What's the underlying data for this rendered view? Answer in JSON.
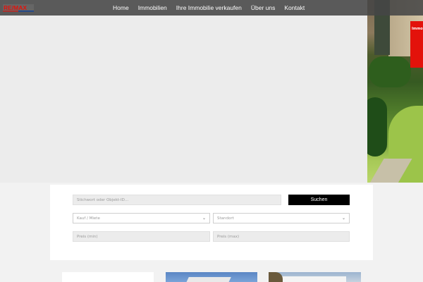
{
  "header": {
    "logo_icon": "remax-logo",
    "nav": [
      {
        "label": "Home"
      },
      {
        "label": "Immobilien"
      },
      {
        "label": "Ihre Immobilie verkaufen"
      },
      {
        "label": "Über uns"
      },
      {
        "label": "Kontakt"
      }
    ]
  },
  "hero": {
    "promo_tab_label": "Immo",
    "promo_color": "#e3120b"
  },
  "search": {
    "keyword_placeholder": "Stichwort oder Objekt-ID...",
    "submit_label": "Suchen",
    "type_select_value": "Kauf / Miete",
    "location_select_value": "Standort",
    "price_min_placeholder": "Preis (min)",
    "price_max_placeholder": "Preis (max)"
  },
  "colors": {
    "brand_red": "#e3120b",
    "brand_blue": "#003da5",
    "button_bg": "#000000"
  }
}
